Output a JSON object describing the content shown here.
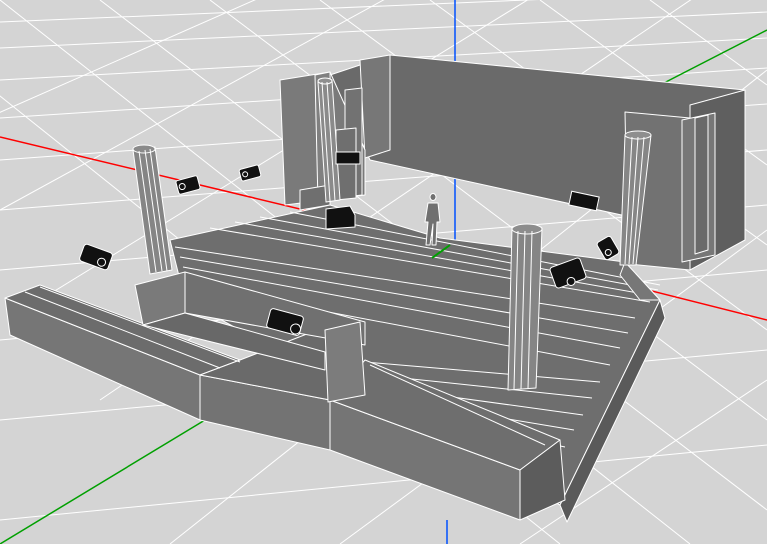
{
  "viewport": {
    "background": "#d4d4d4",
    "grid_color": "#ffffff",
    "axis_colors": {
      "x": "#ff0000",
      "y": "#00a000",
      "z": "#0050ff"
    }
  },
  "model": {
    "face_color": "#6e6e6e",
    "edge_color": "#ffffff",
    "parts": [
      "stage-floor",
      "stage-planks",
      "back-wall",
      "right-wall",
      "left-wall-flat",
      "front-left-platform",
      "front-right-platform",
      "column-left-front",
      "column-back-left",
      "column-right-back",
      "column-center-front",
      "human-figure"
    ],
    "speakers": {
      "count": 10,
      "icon": "speaker-icon",
      "color": "#111111"
    }
  }
}
